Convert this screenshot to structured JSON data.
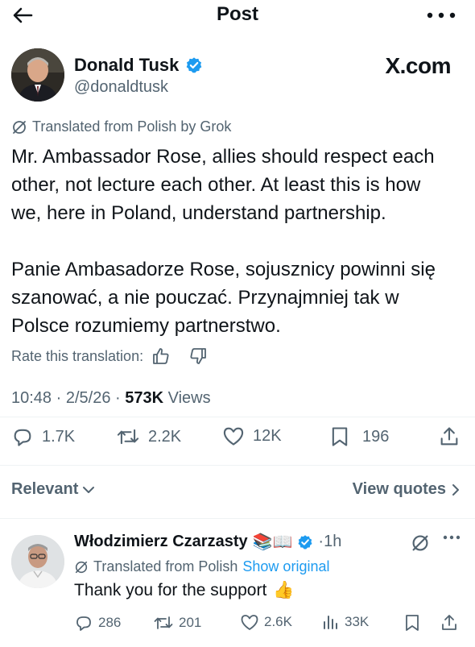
{
  "header": {
    "title": "Post"
  },
  "post": {
    "author_name": "Donald Tusk",
    "author_handle": "@donaldtusk",
    "brand": "X.com",
    "translated_label": "Translated from Polish by Grok",
    "text_en_1": "Mr. Ambassador Rose, allies should respect each",
    "text_en_2": "other, not lecture each other. At least this is how",
    "text_en_3": "we, here in Poland, understand partnership.",
    "text_pl_1": "Panie Ambasadorze Rose, sojusznicy powinni się",
    "text_pl_2": "szanować, a nie pouczać. Przynajmniej tak w",
    "text_pl_3": "Polsce rozumiemy partnerstwo.",
    "rate_label": "Rate this translation:",
    "time": "10:48",
    "date": "2/5/26",
    "views_count": "573K",
    "views_label": "Views",
    "replies": "1.7K",
    "reposts": "2.2K",
    "likes": "12K",
    "bookmarks": "196",
    "verified_color": "#1d9bf0"
  },
  "filters": {
    "relevant_label": "Relevant",
    "view_quotes_label": "View quotes"
  },
  "reply": {
    "author_name": "Włodzimierz Czarzasty",
    "emojis": "📚📖",
    "time": "·1h",
    "translated_label": "Translated from Polish",
    "show_original": "Show original",
    "text": "Thank you for the support",
    "emoji_end": "👍",
    "replies": "286",
    "reposts": "201",
    "likes": "2.6K",
    "views": "33K"
  }
}
